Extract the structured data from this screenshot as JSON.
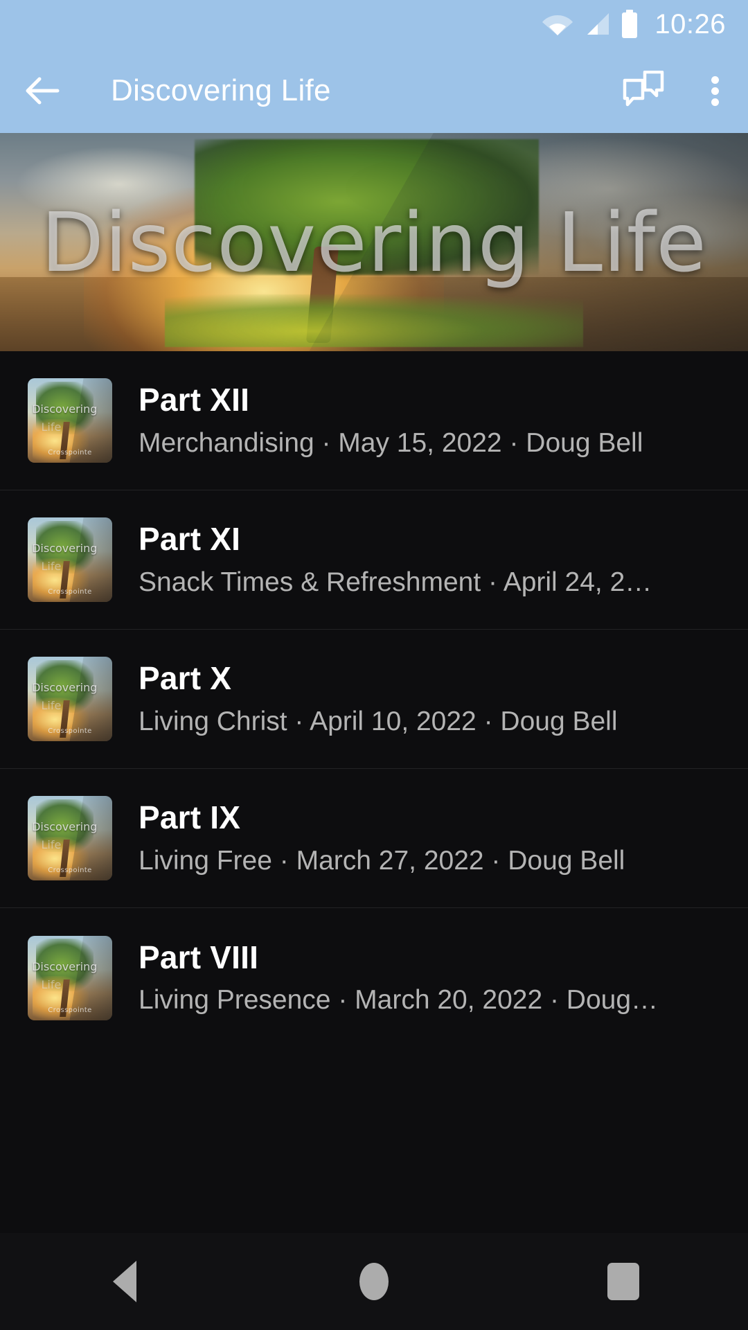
{
  "status_bar": {
    "time": "10:26",
    "icons": [
      "wifi-icon",
      "cell-signal-icon",
      "battery-icon"
    ],
    "background_color": "#9dc3e8"
  },
  "app_bar": {
    "back_label": "←",
    "title": "Discovering Life",
    "actions": [
      {
        "name": "chat-icon",
        "glyph": ""
      },
      {
        "name": "overflow-menu-icon",
        "glyph": ""
      }
    ],
    "background_color": "#9dc3e8",
    "text_color": "#ffffff"
  },
  "hero": {
    "title": "Discovering Life",
    "alt": "sunset tree series artwork banner"
  },
  "thumbnail": {
    "line1": "Discovering",
    "line2": "Life",
    "line3": "Crosspointe"
  },
  "list": {
    "items": [
      {
        "title": "Part XII",
        "subtitle": "Merchandising · May 15, 2022 · Doug Bell"
      },
      {
        "title": "Part XI",
        "subtitle": "Snack Times & Refreshment · April 24, 2…"
      },
      {
        "title": "Part X",
        "subtitle": "Living Christ · April 10, 2022 · Doug Bell"
      },
      {
        "title": "Part IX",
        "subtitle": "Living Free · March 27, 2022 · Doug Bell"
      },
      {
        "title": "Part VIII",
        "subtitle": "Living Presence · March 20, 2022 · Doug…"
      }
    ],
    "background_color": "#0d0d0f",
    "title_color": "#ffffff",
    "subtitle_color": "#b4b4b4"
  },
  "system_nav": {
    "buttons": [
      "back-nav-button",
      "home-nav-button",
      "recents-nav-button"
    ],
    "background_color": "#111113"
  }
}
